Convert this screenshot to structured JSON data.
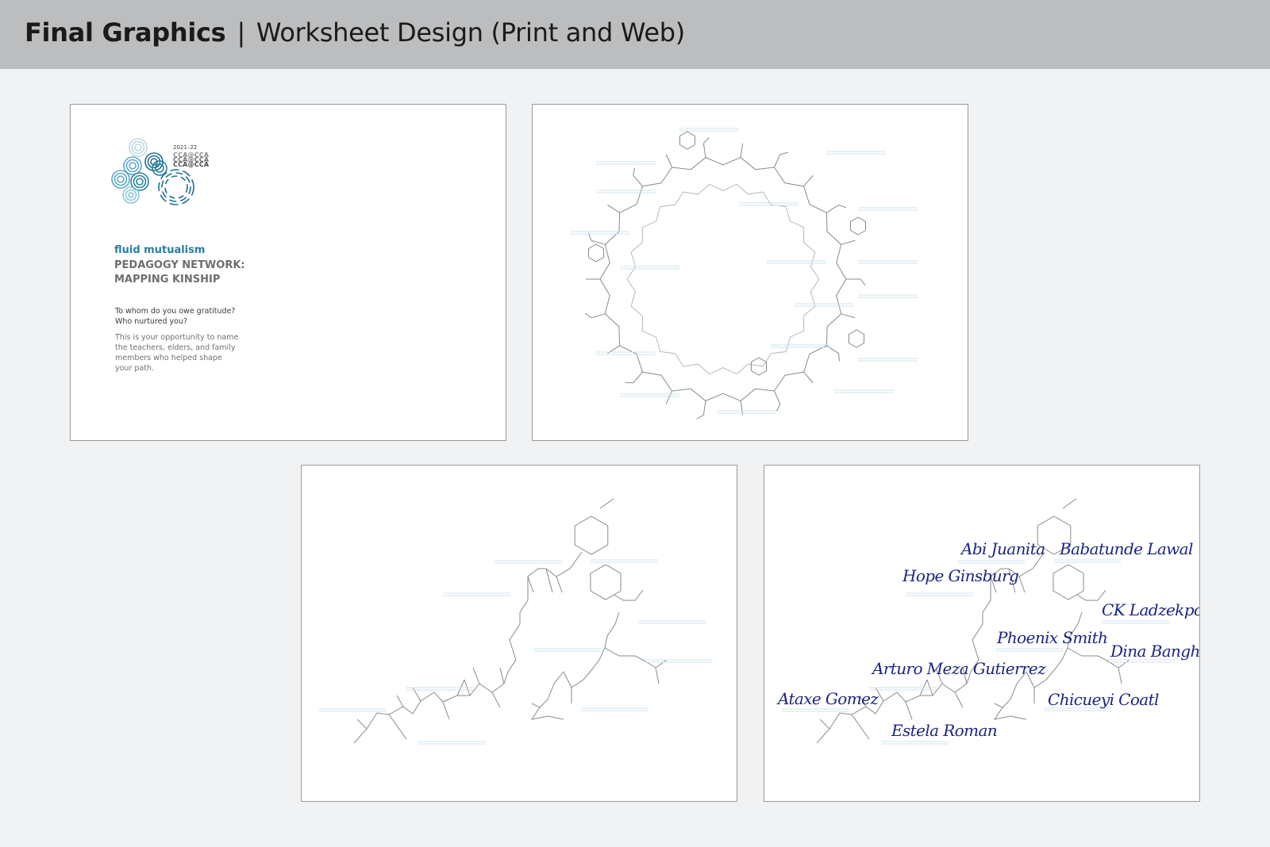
{
  "header": {
    "title_bold": "Final Graphics",
    "separator": "|",
    "title_rest": "Worksheet Design (Print and Web)"
  },
  "cover": {
    "logo": {
      "year": "2021–22",
      "marks": [
        "CCA@CCA",
        "CCA@CCA",
        "CCA@CCA"
      ]
    },
    "subtitle": "fluid mutualism",
    "title_line1": "PEDAGOGY NETWORK:",
    "title_line2": "MAPPING KINSHIP",
    "question_line1": "To whom do you owe gratitude?",
    "question_line2": "Who nurtured you?",
    "description_lines": [
      "This is your opportunity to name",
      "the teachers, elders, and family",
      "members who helped shape",
      "your path."
    ]
  },
  "filled_names": [
    "Abi Juanita",
    "Babatunde Lawal",
    "Hope Ginsburg",
    "CK Ladzekpo",
    "Phoenix Smith",
    "Dina Banghel",
    "Arturo Meza Gutierrez",
    "Ataxe Gomez",
    "Chicueyi Coatl",
    "Estela Roman"
  ],
  "colors": {
    "header_bg": "#bcbdbf",
    "page_bg": "#f1f2f4",
    "accent_teal": "#2a7ea3",
    "handwriting": "#1c2580",
    "line_gray": "#8a8a8a",
    "blank_line_blue": "#cfe3ec"
  }
}
